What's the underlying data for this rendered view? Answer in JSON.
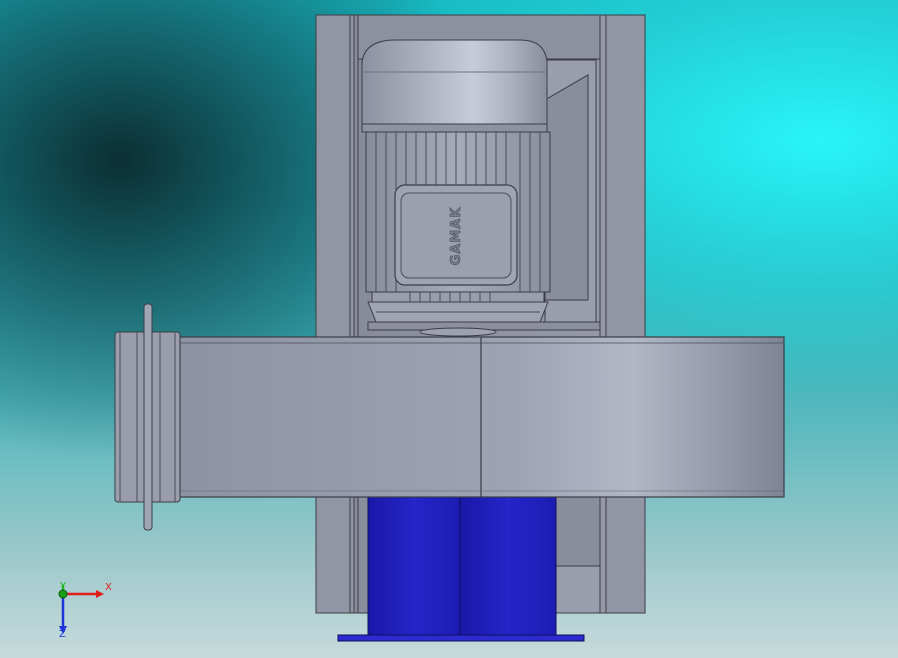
{
  "model": {
    "brand_label": "GAMAK"
  },
  "triad": {
    "x_label": "X",
    "y_label": "Y",
    "z_label": "Z",
    "x_color": "#e21b1b",
    "y_color": "#1fb61f",
    "z_color": "#1d34d8"
  },
  "colors": {
    "housing": "#9da2b1",
    "motor": "#a5a9b8",
    "stand": "#2222c4",
    "frame": "#8e929f"
  }
}
